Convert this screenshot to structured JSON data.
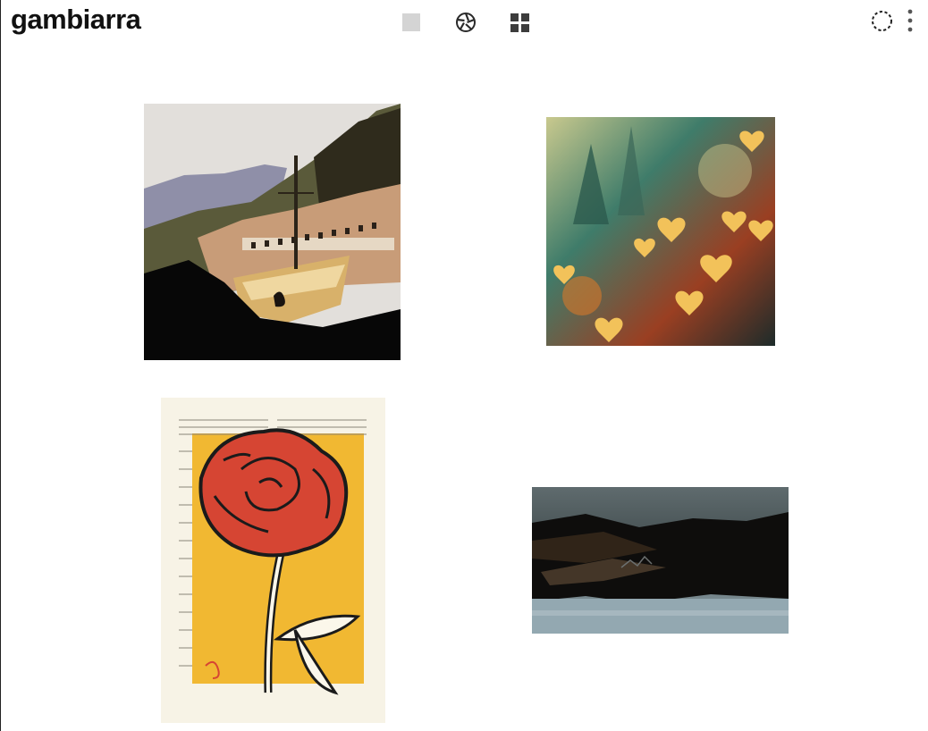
{
  "app": {
    "title": "gambiarra"
  },
  "toolbar": {
    "view_single_icon": "square-icon",
    "view_shuffle_icon": "aperture-icon",
    "view_grid_icon": "grid-icon",
    "loading_icon": "loading-circle-icon",
    "menu_icon": "more-vertical-icon"
  },
  "colors": {
    "text": "#111111",
    "icon": "#3c3c3c",
    "single_view_square": "#d4d4d4",
    "background": "#ffffff"
  },
  "gallery": {
    "items": [
      {
        "name": "artwork-boat"
      },
      {
        "name": "artwork-hearts-bokeh"
      },
      {
        "name": "artwork-rose-dictionary"
      },
      {
        "name": "artwork-dark-landscape"
      }
    ]
  }
}
